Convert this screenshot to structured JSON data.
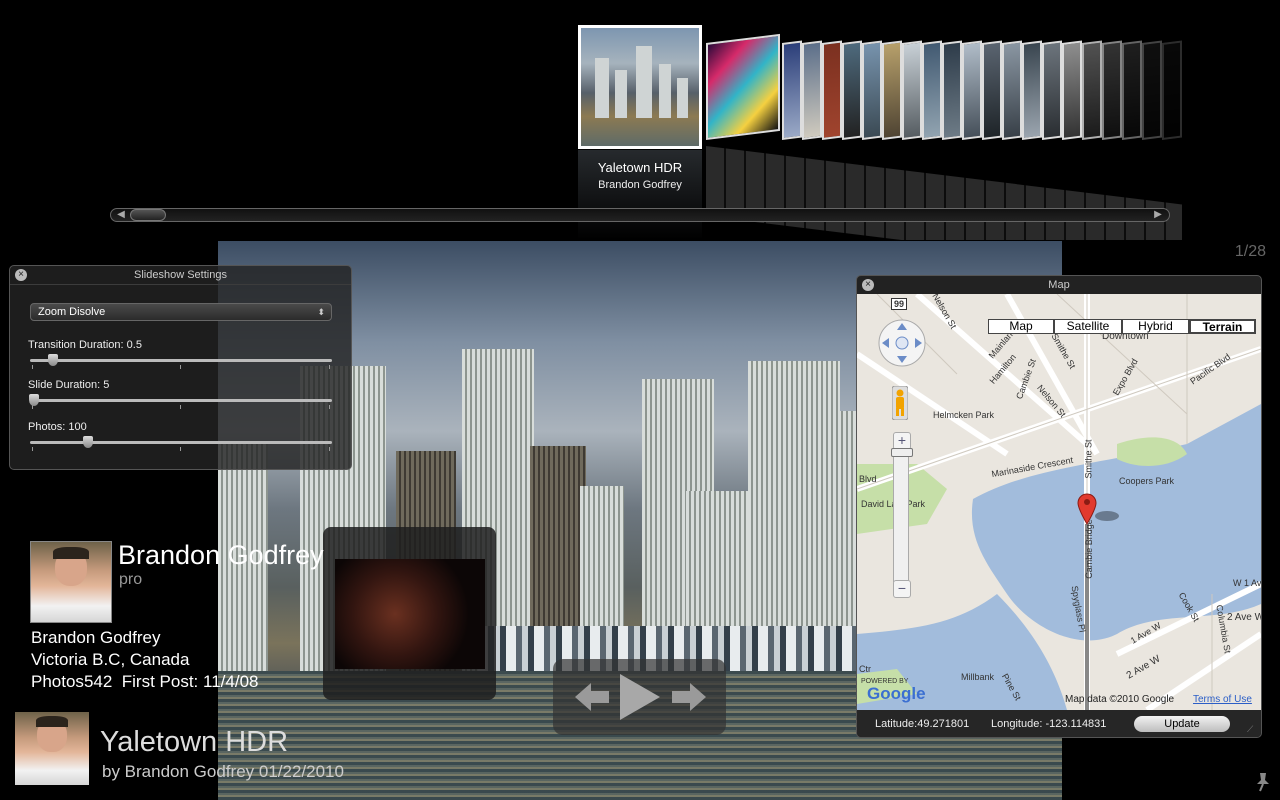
{
  "coverflow": {
    "current_title": "Yaletown HDR",
    "current_author": "Brandon Godfrey"
  },
  "photo": {
    "counter": "1/28"
  },
  "slideshow_settings": {
    "title": "Slideshow Settings",
    "transition": "Zoom Disolve",
    "transition_duration_label": "Transition Duration:",
    "transition_duration": "0.5",
    "slide_duration_label": "Slide Duration:",
    "slide_duration": "5",
    "photos_label": "Photos:",
    "photos": "100"
  },
  "profile": {
    "name": "Brandon Godfrey",
    "account_type": "pro",
    "full_name": "Brandon Godfrey",
    "location": "Victoria B.C, Canada",
    "photos_label": "Photos",
    "photos_count": "542",
    "first_post_label": "First Post:",
    "first_post": "11/4/08"
  },
  "caption": {
    "title": "Yaletown HDR",
    "byline": "by Brandon Godfrey 01/22/2010"
  },
  "map": {
    "title": "Map",
    "type_buttons": [
      "Map",
      "Satellite",
      "Hybrid",
      "Terrain"
    ],
    "selected_type": "Terrain",
    "labels": [
      "Nelson St",
      "Mainland St",
      "Smithe St",
      "Hamilton",
      "Downtown",
      "Pacific Blvd",
      "Expo Blvd",
      "Helmcken Park",
      "Cambie St",
      "Nelson St",
      "Marinaside Crescent",
      "Smithe St",
      "Coopers Park",
      "David Lam Park",
      "Cambie Bridge",
      "Spyglass Pl",
      "W 1 Av",
      "2 Ave W",
      "Cook St",
      "Columbia St",
      "1 Ave W",
      "2 Ave W",
      "Millbank",
      "Ctr",
      "Blvd",
      "Pine St",
      "99"
    ],
    "powered_by": "POWERED BY",
    "brand": "Google",
    "map_data": "Map data ©2010 Google",
    "terms": "Terms of Use",
    "latitude_label": "Latitude:",
    "latitude": "49.271801",
    "longitude_label": "Longitude:",
    "longitude": "-123.114831",
    "update_label": "Update"
  },
  "icons": {
    "close": "close-icon",
    "pan": "pan-control-icon",
    "pegman": "pegman-icon",
    "marker": "map-marker-icon",
    "prev": "previous-arrow-icon",
    "play": "play-icon",
    "next": "next-arrow-icon",
    "pin": "pin-icon"
  },
  "colors": {
    "marker": "#e23a2e",
    "water": "#a2bcdc",
    "park": "#c6dfa8"
  }
}
